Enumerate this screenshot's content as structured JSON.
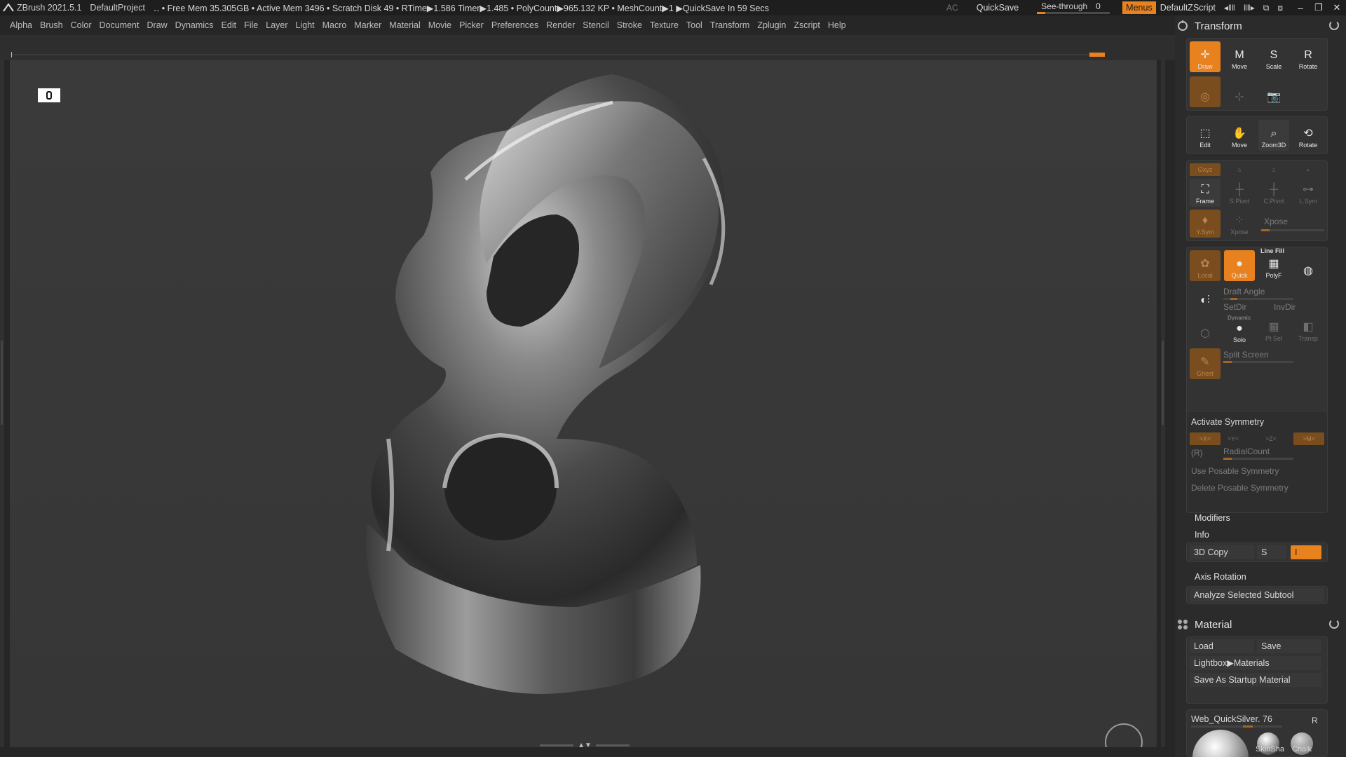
{
  "titlebar": {
    "app": "ZBrush 2021.5.1",
    "project": "DefaultProject",
    "stats": "‥ • Free Mem 35.305GB • Active Mem 3496 • Scratch Disk 49 • RTime▶1.586 Timer▶1.485 • PolyCount▶965.132 KP • MeshCount▶1 ▶QuickSave In 59 Secs",
    "ac": "AC",
    "quicksave": "QuickSave",
    "see_through_label": "See-through",
    "see_through_value": "0",
    "menus": "Menus",
    "script": "DefaultZScript"
  },
  "menubar": {
    "items": [
      "Alpha",
      "Brush",
      "Color",
      "Document",
      "Draw",
      "Dynamics",
      "Edit",
      "File",
      "Layer",
      "Light",
      "Macro",
      "Marker",
      "Material",
      "Movie",
      "Picker",
      "Preferences",
      "Render",
      "Stencil",
      "Stroke",
      "Texture",
      "Tool",
      "Transform",
      "Zplugin",
      "Zscript",
      "Help"
    ]
  },
  "transform": {
    "title": "Transform",
    "draw": "Draw",
    "move": "Move",
    "scale": "Scale",
    "rotate": "Rotate",
    "edit": "Edit",
    "move2": "Move",
    "zoom3d": "Zoom3D",
    "rotate2": "Rotate",
    "xyz": "Gxyz",
    "frame": "Frame",
    "spivot": "S.Pivot",
    "cpivot": "C.Pivot",
    "lsym": "L.Sym",
    "ysym": "Y.Sym",
    "xpose_btn": "Xpose",
    "xpose_label": "Xpose",
    "local": "Local",
    "quick": "Quick",
    "linefill": "Line Fill",
    "polyf": "PolyF",
    "draft_angle": "Draft Angle",
    "setdir": "SetDir",
    "invdir": "InvDir",
    "dynamic": "Dynamic",
    "solo": "Solo",
    "ptsel": "Pt Sel",
    "transp": "Transp",
    "split_screen": "Split Screen",
    "ghost": "Ghost",
    "activate_symmetry": "Activate Symmetry",
    "sym_x": ">X<",
    "sym_y": ">Y<",
    "sym_z": ">Z<",
    "sym_m": ">M<",
    "sym_r": "(R)",
    "radial_count": "RadialCount",
    "use_posable": "Use Posable Symmetry",
    "delete_posable": "Delete Posable Symmetry",
    "modifiers": "Modifiers",
    "info": "Info",
    "copy3d": "3D Copy",
    "copy_s": "S",
    "copy_i": "I",
    "axis_rotation": "Axis Rotation",
    "analyze": "Analyze Selected Subtool"
  },
  "material": {
    "title": "Material",
    "load": "Load",
    "save": "Save",
    "lightbox": "Lightbox▶Materials",
    "startup": "Save As Startup Material",
    "current": "Web_QuickSilver. 76",
    "current_r": "R",
    "thumb1": "SkinSha",
    "thumb2": "Chalk"
  },
  "colors": {
    "accent": "#e8821e",
    "panel_bg": "#2b2b2b",
    "viewport_bg": "#3a3a3a"
  }
}
